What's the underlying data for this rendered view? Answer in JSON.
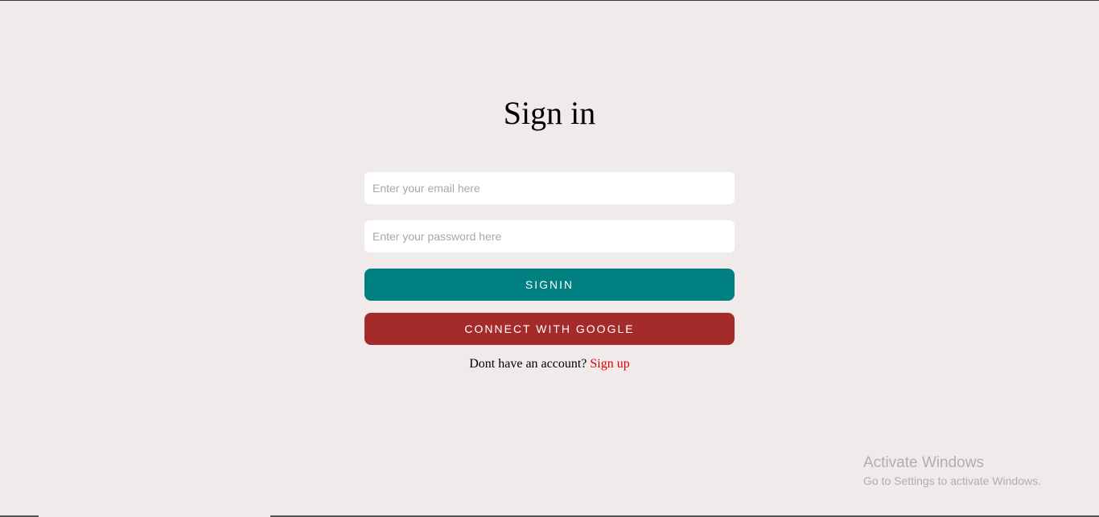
{
  "page": {
    "title": "Sign in"
  },
  "form": {
    "email_placeholder": "Enter your email here",
    "password_placeholder": "Enter your password here",
    "signin_label": "Signin",
    "google_label": "Connect with Google",
    "no_account_text": "Dont have an account?",
    "signup_link": "Sign up"
  },
  "watermark": {
    "title": "Activate Windows",
    "subtitle": "Go to Settings to activate Windows."
  },
  "colors": {
    "background": "#f0eaea",
    "signin_button": "#008080",
    "google_button": "#a52a2a",
    "signup_link": "#e00000"
  }
}
